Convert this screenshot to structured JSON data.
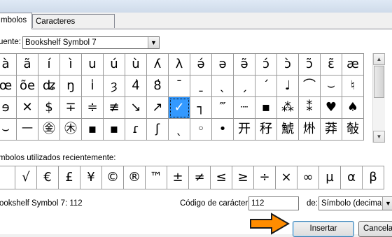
{
  "tabs": [
    {
      "label": "mbolos"
    },
    {
      "label": "Caracteres especiales"
    }
  ],
  "font": {
    "label": "uente:",
    "value": "Bookshelf Symbol 7"
  },
  "grid": [
    [
      "à",
      "ã",
      "í",
      "ì",
      "u",
      "ú",
      "ù",
      "ʎ",
      "λ",
      "ə́",
      "ə",
      "ə̃",
      "ɔ́",
      "ɔ̀",
      "ɔ̃",
      "ɛ̃",
      "æ"
    ],
    [
      "œ",
      "õe",
      "ʥ",
      "ŋ",
      "ı̍",
      "ȝ",
      "4̍",
      "8̍",
      "ˉ",
      "ˍ",
      "ˎ",
      "ˏ",
      "ˊ",
      "♩",
      "⌒",
      "⌣",
      "♮"
    ],
    [
      "ɘ",
      "✕",
      "$",
      "∓",
      "≑",
      "≢",
      "↘",
      "↗",
      "✓",
      "┐",
      "‴",
      "┈",
      "▪",
      "⁂",
      "⁑",
      "♥",
      "♠"
    ],
    [
      "⌣",
      "ㅡ",
      "㊎",
      "㊍",
      "▪",
      "▪",
      "ɾ",
      "ʃ",
      "ˎ",
      "◦",
      "•",
      "开",
      "秄",
      "鯱",
      "烞",
      "莽",
      "敧"
    ]
  ],
  "last_col": [
    "æ",
    "○",
    "⌒",
    ""
  ],
  "recent_label": "mbolos utilizados recientemente:",
  "recent": [
    "",
    "√",
    "€",
    "£",
    "¥",
    "©",
    "®",
    "™",
    "±",
    "≠",
    "≤",
    "≥",
    "÷",
    "×",
    "∞",
    "µ",
    "α",
    "β"
  ],
  "status_text": "ookshelf Symbol 7: 112",
  "code": {
    "label": "Código de carácter:",
    "value": "112"
  },
  "from": {
    "label": "de:",
    "value": "Símbolo (decimal)"
  },
  "buttons": {
    "insert": "Insertar",
    "cancel": "Cancelar"
  },
  "colors": {
    "selected": "#3399ff",
    "arrow": "#ff8c00"
  }
}
